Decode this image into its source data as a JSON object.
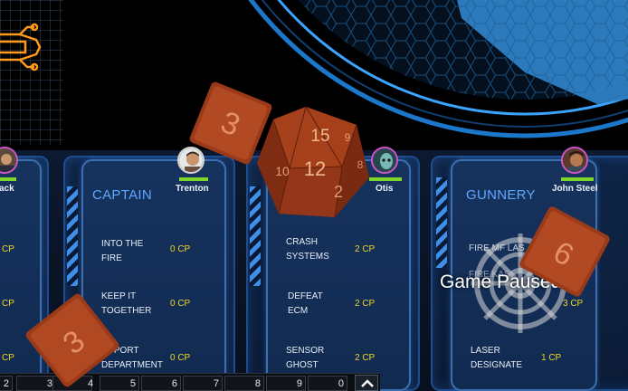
{
  "game_state": "Game Paused",
  "columns": [
    {
      "player_name": "ack",
      "abilities": [
        {
          "points": "CP"
        },
        {
          "points": "CP"
        },
        {
          "points": "CP"
        }
      ]
    },
    {
      "role": "CAPTAIN",
      "player_name": "Trenton",
      "abilities": [
        {
          "name": "INTO THE\nFIRE",
          "points": "0 CP"
        },
        {
          "name": "KEEP IT\nTOGETHER",
          "points": "0 CP"
        },
        {
          "name": "UPPORT\nDEPARTMENT",
          "points": "0 CP"
        }
      ]
    },
    {
      "player_name": "Otis",
      "abilities": [
        {
          "name": "CRASH\nSYSTEMS",
          "points": "2 CP"
        },
        {
          "name": "DEFEAT\nECM",
          "points": "2 CP"
        },
        {
          "name": "SENSOR\nGHOST",
          "points": "2 CP"
        }
      ]
    },
    {
      "role": "GUNNERY",
      "player_name": "John Steel",
      "abilities": [
        {
          "name": "FIRE MF LAS",
          "points": ""
        },
        {
          "name": "FIRE KAS",
          "points": "3 CP"
        },
        {
          "name": "LASER\nDESIGNATE",
          "points": "1 CP"
        }
      ]
    }
  ],
  "hotbar": {
    "slots": [
      "2",
      "3",
      "4",
      "5",
      "6",
      "7",
      "8",
      "9",
      "0"
    ],
    "up_icon": "chevron-up-icon"
  },
  "dice": {
    "d20_faces": [
      "15",
      "12",
      "2",
      "10",
      "9",
      "8"
    ],
    "d6_top": "3",
    "d6_bottom_left": "3",
    "d6_right": "6"
  },
  "colors": {
    "panel_title": "#5fa8ff",
    "cp_value": "#f0d428",
    "hp_bar": "#7ed62a",
    "dice": "#9a3a18"
  }
}
